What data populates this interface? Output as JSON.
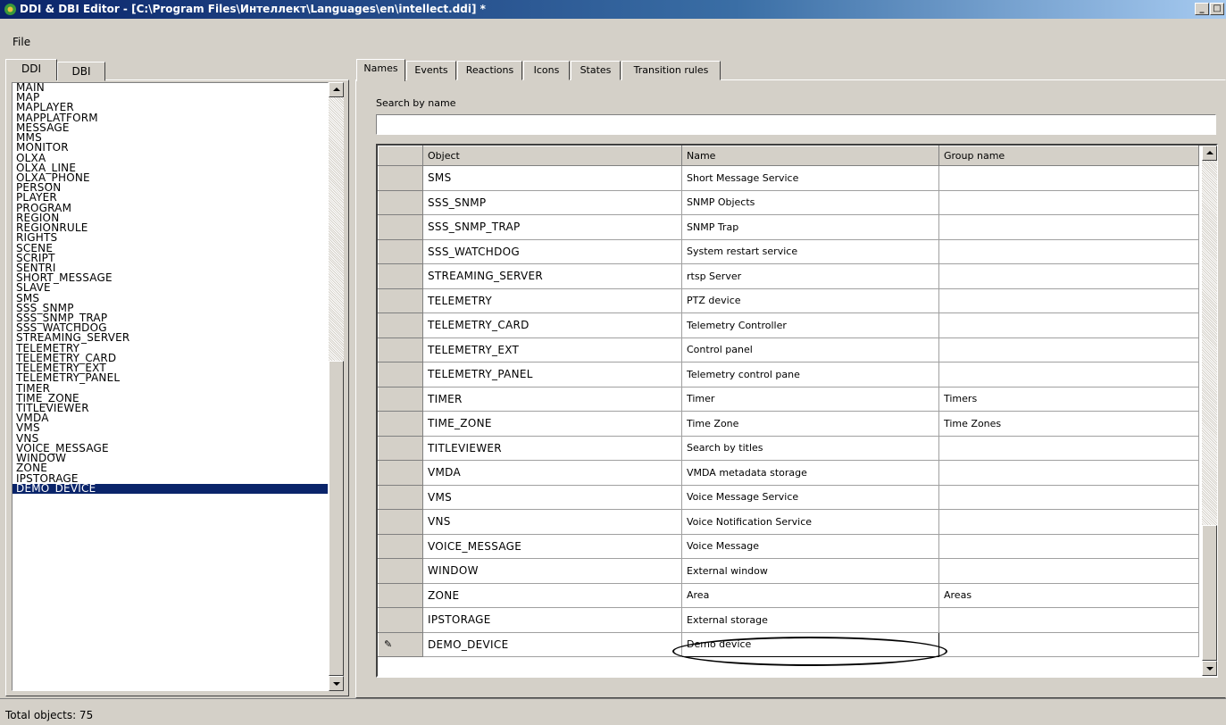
{
  "window": {
    "title": "DDI & DBI Editor - [C:\\Program Files\\Интеллект\\Languages\\en\\intellect.ddi] *",
    "minimize": "_",
    "maximize": "□"
  },
  "menu": {
    "file": "File"
  },
  "left_tabs": [
    "DDI",
    "DBI"
  ],
  "left_list": {
    "items": [
      "MAIN",
      "MAP",
      "MAPLAYER",
      "MAPPLATFORM",
      "MESSAGE",
      "MMS",
      "MONITOR",
      "OLXA",
      "OLXA_LINE",
      "OLXA_PHONE",
      "PERSON",
      "PLAYER",
      "PROGRAM",
      "REGION",
      "REGIONRULE",
      "RIGHTS",
      "SCENE",
      "SCRIPT",
      "SENTRI",
      "SHORT_MESSAGE",
      "SLAVE",
      "SMS",
      "SSS_SNMP",
      "SSS_SNMP_TRAP",
      "SSS_WATCHDOG",
      "STREAMING_SERVER",
      "TELEMETRY",
      "TELEMETRY_CARD",
      "TELEMETRY_EXT",
      "TELEMETRY_PANEL",
      "TIMER",
      "TIME_ZONE",
      "TITLEVIEWER",
      "VMDA",
      "VMS",
      "VNS",
      "VOICE_MESSAGE",
      "WINDOW",
      "ZONE",
      "IPSTORAGE",
      "DEMO_DEVICE"
    ],
    "selected": "DEMO_DEVICE"
  },
  "right_tabs": [
    "Names",
    "Events",
    "Reactions",
    "Icons",
    "States",
    "Transition rules"
  ],
  "search": {
    "label": "Search by name",
    "value": ""
  },
  "grid": {
    "columns": [
      "Object",
      "Name",
      "Group name"
    ],
    "rows": [
      {
        "object": "SMS",
        "name": "Short Message Service",
        "group": ""
      },
      {
        "object": "SSS_SNMP",
        "name": "SNMP Objects",
        "group": ""
      },
      {
        "object": "SSS_SNMP_TRAP",
        "name": "SNMP Trap",
        "group": ""
      },
      {
        "object": "SSS_WATCHDOG",
        "name": "System restart service",
        "group": ""
      },
      {
        "object": "STREAMING_SERVER",
        "name": "rtsp Server",
        "group": ""
      },
      {
        "object": "TELEMETRY",
        "name": "PTZ device",
        "group": ""
      },
      {
        "object": "TELEMETRY_CARD",
        "name": "Telemetry Controller",
        "group": ""
      },
      {
        "object": "TELEMETRY_EXT",
        "name": "Control panel",
        "group": ""
      },
      {
        "object": "TELEMETRY_PANEL",
        "name": "Telemetry control pane",
        "group": ""
      },
      {
        "object": "TIMER",
        "name": "Timer",
        "group": "Timers"
      },
      {
        "object": "TIME_ZONE",
        "name": "Time Zone",
        "group": "Time Zones"
      },
      {
        "object": "TITLEVIEWER",
        "name": "Search by titles",
        "group": ""
      },
      {
        "object": "VMDA",
        "name": "VMDA metadata storage",
        "group": ""
      },
      {
        "object": "VMS",
        "name": "Voice Message Service",
        "group": ""
      },
      {
        "object": "VNS",
        "name": "Voice Notification Service",
        "group": ""
      },
      {
        "object": "VOICE_MESSAGE",
        "name": "Voice Message",
        "group": ""
      },
      {
        "object": "WINDOW",
        "name": "External window",
        "group": ""
      },
      {
        "object": "ZONE",
        "name": "Area",
        "group": "Areas"
      },
      {
        "object": "IPSTORAGE",
        "name": "External storage",
        "group": ""
      },
      {
        "object": "DEMO_DEVICE",
        "name": "Demo device",
        "group": "",
        "editing": true
      }
    ]
  },
  "status": {
    "text": "Total objects: 75"
  },
  "colors": {
    "selection": "#0a246a",
    "face": "#d4d0c8"
  }
}
